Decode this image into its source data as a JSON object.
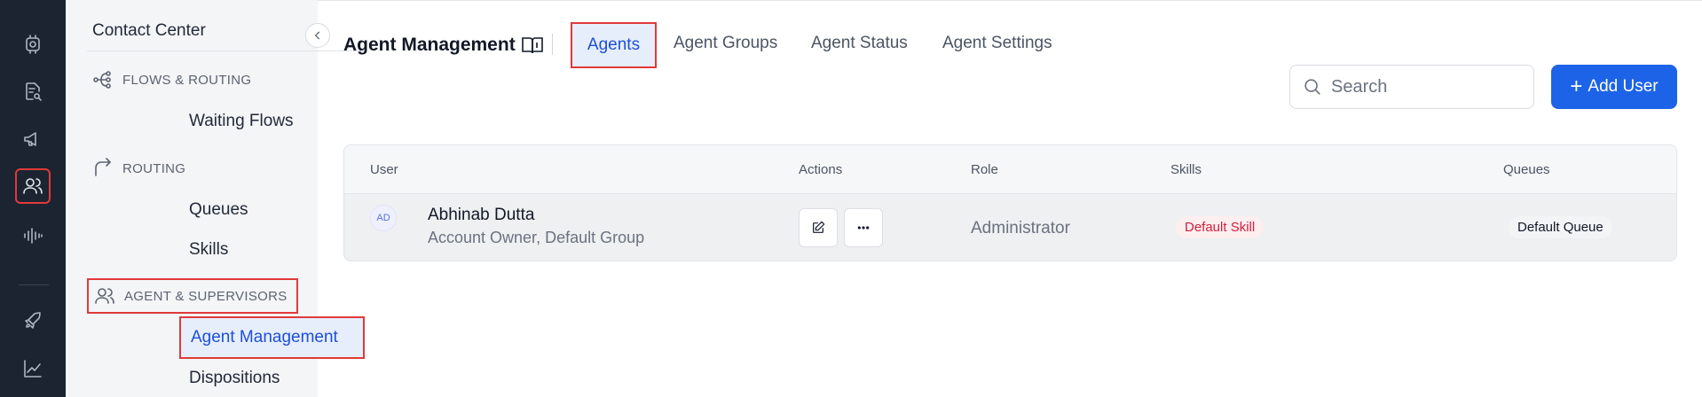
{
  "rail": {
    "items": [
      {
        "icon": "settings-chip-icon"
      },
      {
        "icon": "document-search-icon"
      },
      {
        "icon": "megaphone-icon"
      },
      {
        "icon": "users-icon",
        "active": true
      },
      {
        "icon": "waveform-icon"
      },
      {
        "icon": "rocket-icon"
      },
      {
        "icon": "line-chart-icon"
      }
    ]
  },
  "sidebar": {
    "title": "Contact Center",
    "sections": [
      {
        "label": "FLOWS & ROUTING",
        "icon": "flow-icon",
        "items": [
          "Waiting Flows"
        ]
      },
      {
        "label": "ROUTING",
        "icon": "route-arrow-icon",
        "items": [
          "Queues",
          "Skills"
        ]
      },
      {
        "label": "AGENT & SUPERVISORS",
        "icon": "users-icon",
        "items": [
          "Agent Management",
          "Dispositions"
        ],
        "active_item": "Agent Management"
      }
    ]
  },
  "header": {
    "title": "Agent Management",
    "title_icon": "book-icon",
    "tabs": [
      "Agents",
      "Agent Groups",
      "Agent Status",
      "Agent Settings"
    ],
    "active_tab": "Agents"
  },
  "search": {
    "placeholder": "Search",
    "value": ""
  },
  "add_button": {
    "label": "Add User"
  },
  "table": {
    "columns": [
      "User",
      "Actions",
      "Role",
      "Skills",
      "Queues"
    ],
    "rows": [
      {
        "initials": "AD",
        "name": "Abhinab Dutta",
        "subtitle": "Account Owner, Default Group",
        "role": "Administrator",
        "skill": "Default Skill",
        "queue": "Default Queue"
      }
    ]
  },
  "colors": {
    "rail_bg": "#1b2430",
    "accent": "#1d63e8",
    "highlight_border": "#e03a3a",
    "skill_badge_text": "#d21f3c"
  }
}
